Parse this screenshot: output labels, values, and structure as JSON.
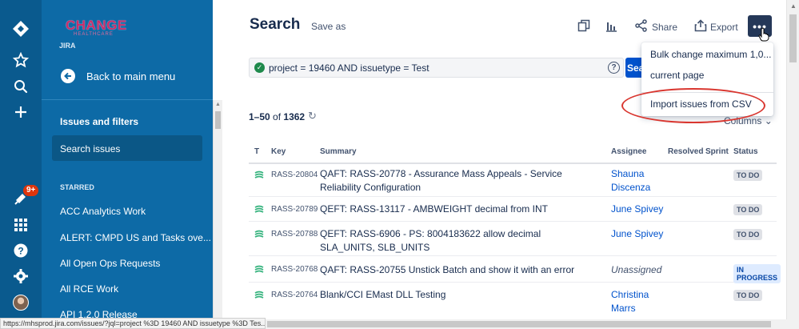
{
  "sidebar": {
    "logo_text": "CHANGE",
    "logo_sub": "HEALTHCARE",
    "project_label": "JIRA",
    "back_label": "Back to main menu",
    "issues_filters": "Issues and filters",
    "search_issues": "Search issues",
    "starred_label": "STARRED",
    "starred_items": [
      "ACC Analytics Work",
      "ALERT: CMPD US and Tasks ove...",
      "All Open Ops Requests",
      "All RCE Work",
      "API 1.2.0 Release"
    ],
    "notification_count": "9+"
  },
  "toolbar": {
    "title": "Search",
    "save_as": "Save as",
    "share": "Share",
    "export": "Export",
    "more": "•••"
  },
  "jql": {
    "query": "project = 19460 AND issuetype = Test",
    "search_button": "Sea"
  },
  "dropdown": {
    "items": [
      "Bulk change maximum 1,0...",
      "current page",
      "Import issues from CSV"
    ]
  },
  "results": {
    "range": "1–50",
    "of": "of",
    "total": "1362",
    "columns_label": "Columns"
  },
  "table": {
    "headers": [
      "T",
      "Key",
      "Summary",
      "Assignee",
      "Resolved",
      "Sprint",
      "Status"
    ],
    "rows": [
      {
        "key": "RASS-20804",
        "summary": "QAFT: RASS-20778 - Assurance Mass Appeals - Service Reliability Configuration",
        "assignee": "Shauna Discenza",
        "status": "TO DO"
      },
      {
        "key": "RASS-20789",
        "summary": "QEFT: RASS-13117 - AMBWEIGHT decimal from INT",
        "assignee": "June Spivey",
        "status": "TO DO"
      },
      {
        "key": "RASS-20788",
        "summary": "QEFT: RASS-6906 - PS: 8004183622 allow decimal SLA_UNITS, SLB_UNITS",
        "assignee": "June Spivey",
        "status": "TO DO"
      },
      {
        "key": "RASS-20768",
        "summary": "QAFT: RASS-20755 Unstick Batch and show it with an error",
        "assignee": "Unassigned",
        "status": "IN PROGRESS"
      },
      {
        "key": "RASS-20764",
        "summary": "Blank/CCI EMast DLL Testing",
        "assignee": "Christina Marrs",
        "status": "TO DO"
      }
    ]
  },
  "statusbar": {
    "url": "https://mhsprod.jira.com/issues/?jql=project %3D 19460 AND issuetype %3D Tes..."
  },
  "colors": {
    "rail": "#0a5a8e",
    "sidebar": "#0d6aa6",
    "primary_button": "#0052cc",
    "more_button": "#253858",
    "annotation": "#d9362f"
  }
}
